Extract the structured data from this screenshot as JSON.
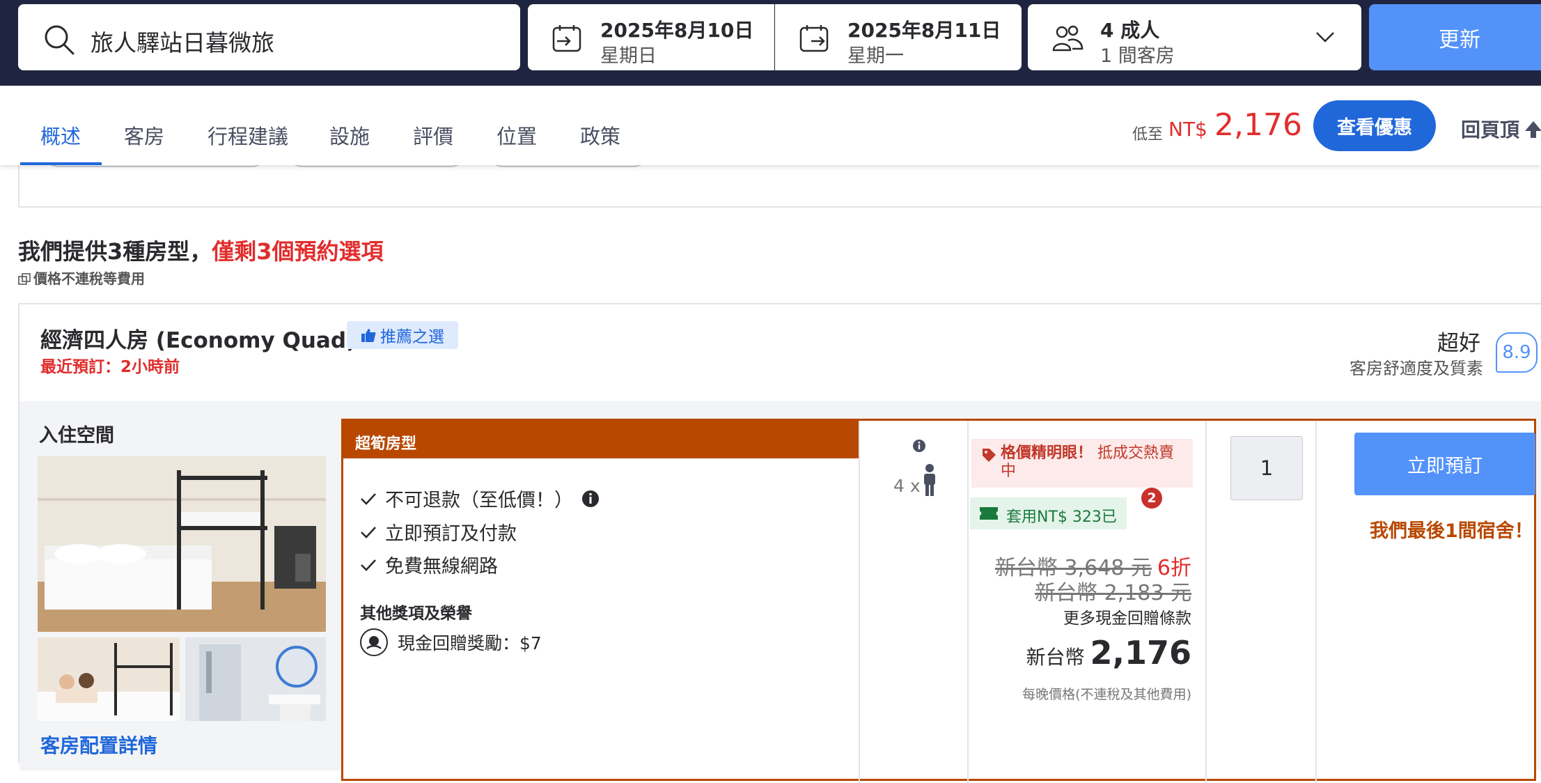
{
  "search": {
    "destination": "旅人驛站日暮微旅",
    "checkin_date": "2025年8月10日",
    "checkin_weekday": "星期日",
    "checkout_date": "2025年8月11日",
    "checkout_weekday": "星期一",
    "guests": "4 成人",
    "rooms": "1 間客房",
    "update_label": "更新"
  },
  "nav": {
    "tabs": [
      {
        "label": "概述"
      },
      {
        "label": "客房"
      },
      {
        "label": "行程建議"
      },
      {
        "label": "設施"
      },
      {
        "label": "評價"
      },
      {
        "label": "位置"
      },
      {
        "label": "政策"
      }
    ],
    "price_from_label": "低至",
    "price_currency": "NT$",
    "price_value": "2,176",
    "deal_button": "查看優惠",
    "back_to_top": "回頁頂"
  },
  "rooms_section": {
    "heading_prefix": "我們提供3種房型，",
    "heading_highlight": "僅剩3個預約選項",
    "tax_note": "價格不連稅等費用"
  },
  "room": {
    "name": "經濟四人房 (Economy Quad)",
    "recommended_badge": "推薦之選",
    "recent_booking": "最近預訂：2小時前",
    "rating_word": "超好",
    "rating_sub": "客房舒適度及質素",
    "rating_score": "8.9",
    "stay_space_label": "入住空間",
    "layout_link": "客房配置詳情",
    "offer": {
      "header": "超筍房型",
      "features": [
        "不可退款（至低價！）",
        "立即預訂及付款",
        "免費無線網路"
      ],
      "other_title": "其他獎項及榮譽",
      "cashback": "現金回贈獎勵：$7",
      "occupancy": "4 x",
      "promo_bold": "格價精明眼！",
      "promo_rest": "抵成交熱賣中",
      "coupon": "套用NT$ 323已",
      "coupon_count": "2",
      "original_price": "新台幣 3,648 元",
      "discount": "6折",
      "second_price": "新台幣 2,183 元",
      "more_cashback": "更多現金回贈條款",
      "final_currency": "新台幣",
      "final_price": "2,176",
      "per_night_note": "每晚價格(不連稅及其他費用)",
      "quantity": "1",
      "book_label": "立即預訂",
      "last_room": "我們最後1間宿舍！"
    }
  },
  "colors": {
    "header_bg": "#1f2540",
    "primary_blue": "#2067da",
    "button_blue": "#5392f9",
    "price_red": "#e12d2d",
    "offer_orange": "#b84800"
  }
}
